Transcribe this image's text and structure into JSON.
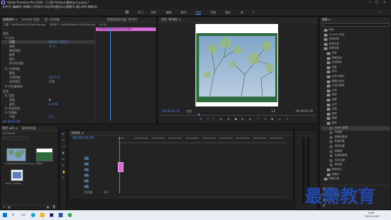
{
  "window": {
    "title": "Adobe Premiere Pro 2020 - C:\\用户\\Videos\\素材\\pr2.prproj *",
    "menu": [
      "文件(F)",
      "编辑(E)",
      "剪辑(C)",
      "序列(S)",
      "标记(M)",
      "图形(G)",
      "视图(V)",
      "窗口(W)",
      "帮助(H)"
    ]
  },
  "workspaces": [
    "学习",
    "组件",
    "编辑",
    "颜色",
    "效果",
    "音频",
    "图形",
    "库"
  ],
  "effect_controls": {
    "tabs": [
      "效果控件 ≡",
      "Lumetri 范围",
      "源: (无剪辑)",
      "音频剪辑混合器: 序列01"
    ],
    "master": "主要 * 1b4f6a2de4f1c3e2a7ba.jpg",
    "clip": "序列01 * 1b4f6a2de4f1c3e2a7ba.jpg",
    "ruler_time": "00:00",
    "clip_bar": "1b4f6a2de4f1c3e2a7ba.jpg",
    "rows": [
      "视频",
      "fx 运动",
      "位置",
      "缩放",
      "缩放宽度",
      "旋转",
      "锚点",
      "防闪烁滤镜",
      "fx 不透明度",
      "蒙版",
      "不透明度",
      "混合模式",
      "fx 时间重映射",
      "音频",
      "fx 音量",
      "旁路",
      "级别",
      "fx 声道音量",
      "fx 声像器",
      "平衡"
    ],
    "values": [
      "960.0",
      "540.0",
      "37.4",
      "100.0",
      "0.0",
      "960.0",
      "0.0",
      "100.0 %",
      "正常",
      "0.0 dB",
      "0.0"
    ],
    "timecode": "00:00:01:05"
  },
  "program": {
    "title": "节目: 序列01 ≡",
    "timecode_left": "00:00:01:05",
    "fit": "适合",
    "quality": "1/2",
    "timecode_right": "00:00:05:00"
  },
  "project": {
    "tabs": [
      "项目: pr2 ≡",
      "媒体浏览器"
    ],
    "filename": "pr2.prproj",
    "items": [
      {
        "name": "1b4f6a2de4f1c3e2a7ba.jpg",
        "dur": "5:00"
      },
      {
        "name": "序列01",
        "dur": "5:00"
      },
      {
        "name": "yellow_rose.jpg",
        "dur": "5:00"
      }
    ]
  },
  "timeline": {
    "tab": "序列01 ≡",
    "timecode": "00:00:01:05",
    "ruler": [
      "00:00",
      "00:00:05:00",
      "00:00:10:00",
      "00:00:15:00",
      "00:00:20:00",
      "00:00:25:00",
      "00:00:30:00",
      "00:00:35:00",
      "00:00:40:00",
      "00:00:45:00"
    ],
    "tracks": [
      "V3",
      "V2",
      "V1",
      "A1",
      "A2",
      "A3"
    ],
    "master": "主声道",
    "master_val": "0.0"
  },
  "effects": {
    "title": "效果 ≡",
    "tree": [
      "预设",
      "Lumetri 预设",
      "音频效果",
      "音频过渡",
      "视频效果",
      "变换",
      "图像控制",
      "实用程序",
      "扭曲",
      "时间",
      "杂色与颗粒",
      "模糊与锐化",
      "沉浸式视频",
      "生成",
      "视频",
      "调整",
      "过时",
      "过渡",
      "透视",
      "通道",
      "键控",
      "Alpha 调整",
      "亮度键",
      "图像遮罩键",
      "差值遮罩",
      "移除遮罩",
      "超级键",
      "轨道遮罩键",
      "非红色键",
      "颜色键",
      "颜色校正",
      "风格化",
      "视频过渡"
    ],
    "bottom": [
      "基本图形",
      "Lumetri 颜色",
      "基本声音",
      "库"
    ]
  },
  "taskbar": {
    "time": "9:46",
    "date": "2021/11/29"
  },
  "watermark": "最需教育"
}
